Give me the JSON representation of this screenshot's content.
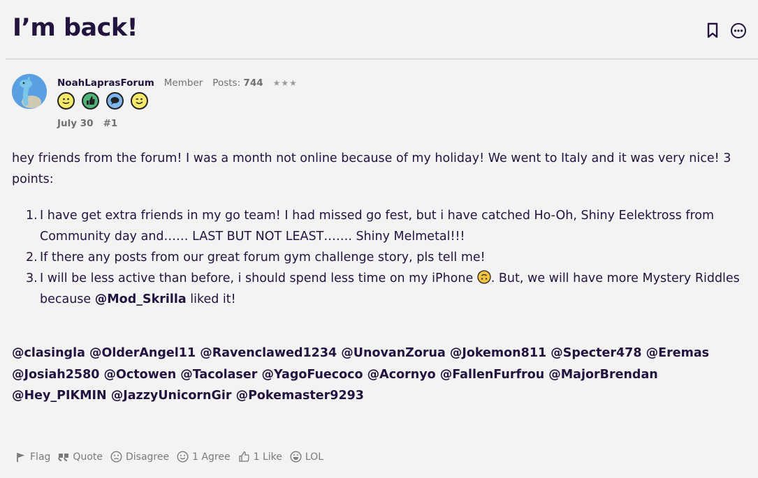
{
  "topic": {
    "title": "I’m back!"
  },
  "author": {
    "username": "NoahLaprasForum",
    "role": "Member",
    "posts_label": "Posts:",
    "posts_count": "744",
    "stars": "★★★",
    "badges": [
      "smile-badge-icon",
      "thumbs-up-badge-icon",
      "speech-bubble-badge-icon",
      "wink-badge-icon"
    ]
  },
  "post": {
    "date": "July 30",
    "number": "#1",
    "intro": "hey friends from the forum! I was a month not online because of my holiday! We went to Italy and it was very nice! 3 points:",
    "items": [
      {
        "num": "1.",
        "text": "I have get extra friends in my go team! I had missed go fest, but i have catched Ho-Oh, Shiny Eelektross from Community day and…… LAST BUT NOT LEAST……. Shiny Melmetal!!!"
      },
      {
        "num": "2.",
        "text": "If there any posts from our great forum gym challenge story, pls tell me!"
      },
      {
        "num": "3.",
        "text_before": "I will be less active than before, i should spend less time on my iPhone ",
        "text_middle": ". But, we will have more Mystery Riddles because ",
        "mention": "@Mod_Skrilla",
        "text_after": " liked it!"
      }
    ],
    "mentions": "@clasingla @OlderAngel11 @Ravenclawed1234 @UnovanZorua @Jokemon811 @Specter478 @Eremas @Josiah2580 @Octowen @Tacolaser @YagoFuecoco @Acornyo @FallenFurfrou @MajorBrendan @Hey_PIKMIN @JazzyUnicornGir @Pokemaster9293"
  },
  "actions": {
    "flag": "Flag",
    "quote": "Quote",
    "disagree": "Disagree",
    "agree": "1 Agree",
    "like": "1 Like",
    "lol": "LOL"
  },
  "colors": {
    "text": "#22133f",
    "muted": "#707070",
    "background": "#f3f3f4",
    "avatar": "#5b9fe3"
  }
}
